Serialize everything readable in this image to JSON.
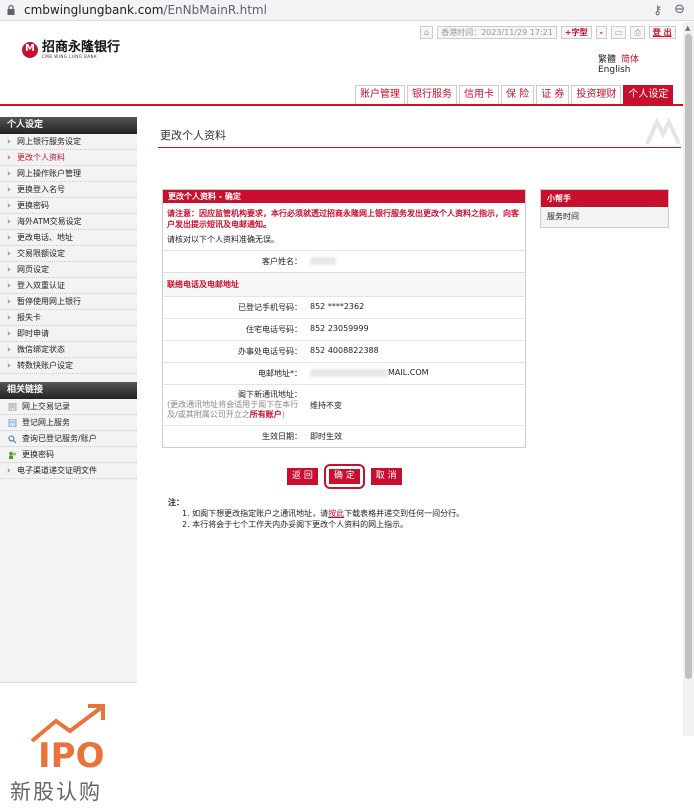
{
  "browser": {
    "url_domain": "cmbwinglungbank.com",
    "url_path": "/EnNbMainR.html"
  },
  "header": {
    "logo_cn": "招商永隆银行",
    "logo_en": "CMB WING LUNG BANK",
    "hk_time_label": "香港时间：",
    "hk_time_value": "2023/11/29 17:21",
    "font_plus": "+字型",
    "font_minus": "-",
    "logout": "登 出",
    "lang_tc": "繁體",
    "lang_sc": "简体",
    "lang_en": "English"
  },
  "mainnav": [
    "账户管理",
    "银行服务",
    "信用卡",
    "保 险",
    "证 券",
    "投资理财",
    "个人设定"
  ],
  "sidebar": {
    "heading": "个人设定",
    "items": [
      "网上银行服务设定",
      "更改个人资料",
      "网上操作账户管理",
      "更换登入名号",
      "更换密码",
      "海外ATM交易设定",
      "更改电话、地址",
      "交易限额设定",
      "网页设定",
      "登入双重认证",
      "暂停使用网上银行",
      "报失卡",
      "即时申请",
      "微信绑定状态",
      "转数快账户设定"
    ],
    "links_heading": "相关链接",
    "links": [
      "网上交易记录",
      "登记网上服务",
      "查询已登记服务/账户",
      "更换密码",
      "电子渠道递交证明文件"
    ]
  },
  "ipo": {
    "big": "IPO",
    "cn": "新股认购"
  },
  "page_title": "更改个人资料",
  "panel": {
    "heading": "更改个人资料 - 确定",
    "warning": "请注意：因应监管机构要求，本行必须就透过招商永隆网上银行服务发出更改个人资料之指示，向客户发出提示短讯及电邮通知。",
    "confirm_text": "请核对以下个人资料准确无误。",
    "name_label": "客户姓名：",
    "contact_section": "联络电话及电邮地址",
    "mobile_label": "已登记手机号码：",
    "mobile_value": "852 ****2362",
    "home_label": "住宅电话号码：",
    "home_value": "852 23059999",
    "office_label": "办事处电话号码：",
    "office_value": "852 4008822388",
    "email_label": "电邮地址*：",
    "email_value": "MAIL.COM",
    "addr_label": "阁下新通讯地址：",
    "addr_note_1": "(更改通讯地址将会适用于阁下在本行及/或其附属公司开立之",
    "addr_note_bold": "所有账户",
    "addr_note_2": ")",
    "addr_value": "维持不变",
    "effective_label": "生效日期：",
    "effective_value": "即时生效"
  },
  "helper": {
    "heading": "小帮手",
    "item": "服务时间"
  },
  "buttons": {
    "back": "返 回",
    "ok": "确 定",
    "cancel": "取 消"
  },
  "notes": {
    "title": "注：",
    "n1_a": "1. 如阁下想更改指定账户之通讯地址，请",
    "n1_link": "按此",
    "n1_b": "下载表格并递交到任何一间分行。",
    "n2": "2. 本行将会于七个工作天内办妥阁下更改个人资料的网上指示。"
  }
}
